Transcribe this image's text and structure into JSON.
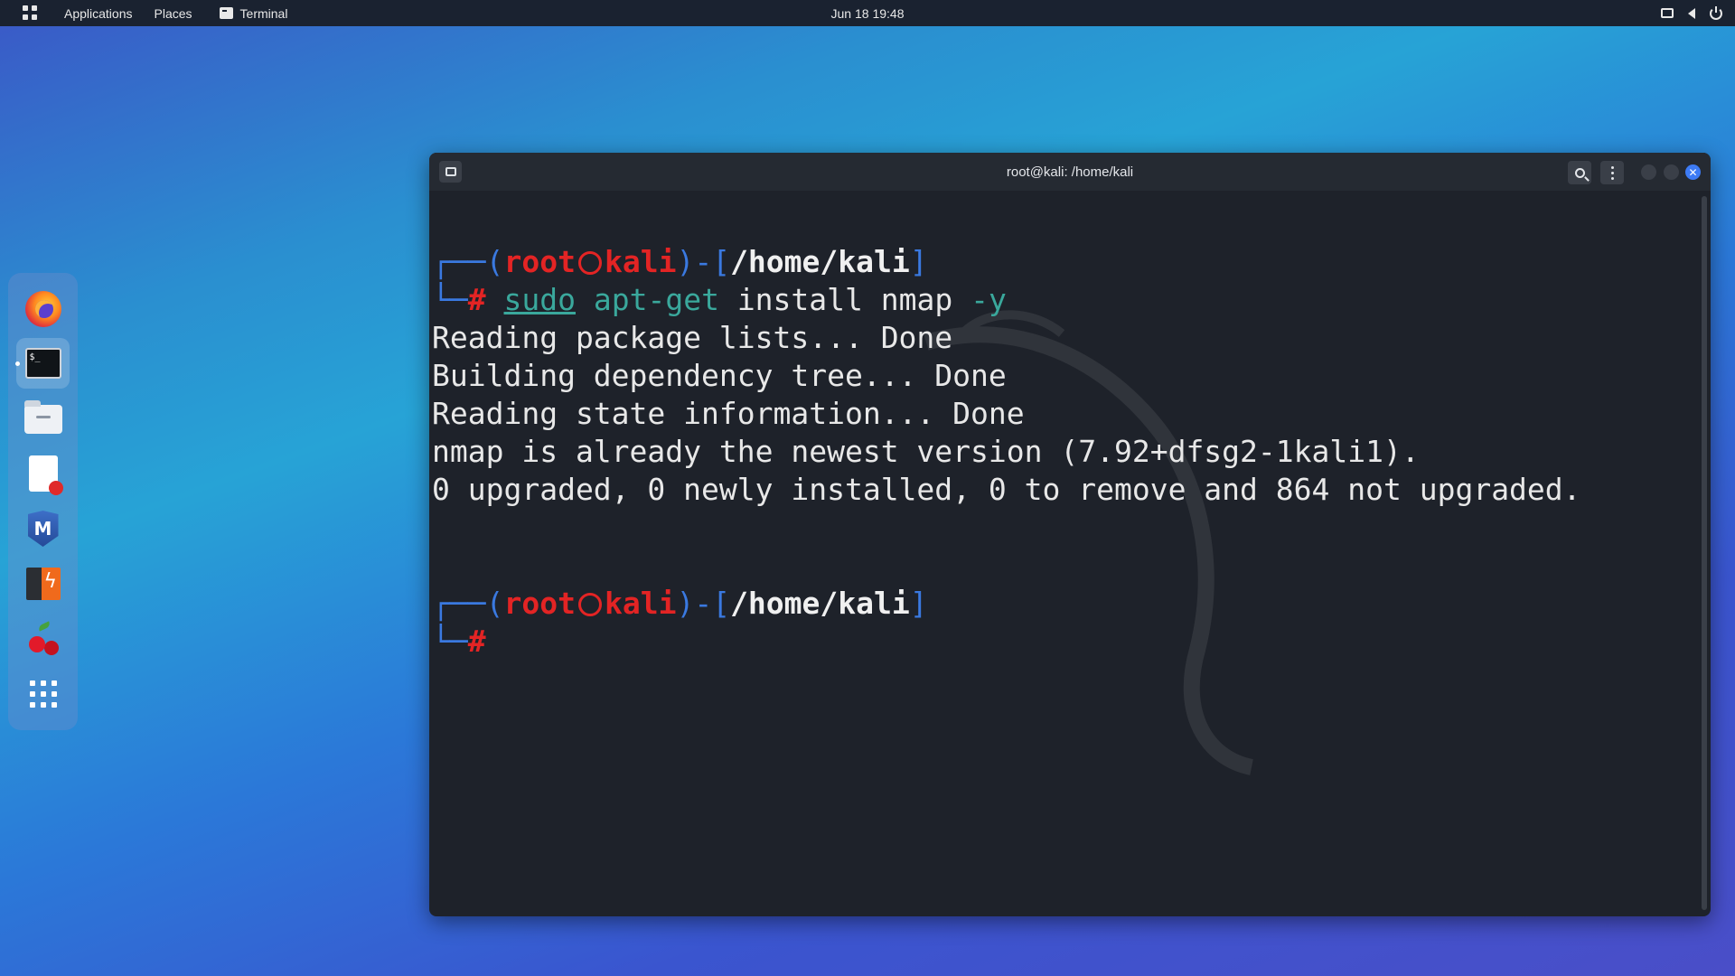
{
  "topbar": {
    "applications": "Applications",
    "places": "Places",
    "terminal_app": "Terminal",
    "clock": "Jun 18  19:48"
  },
  "dock": {
    "items": [
      {
        "name": "firefox"
      },
      {
        "name": "terminal",
        "active": true
      },
      {
        "name": "files"
      },
      {
        "name": "text-editor"
      },
      {
        "name": "metasploit"
      },
      {
        "name": "burp-suite"
      },
      {
        "name": "cherrytree"
      },
      {
        "name": "show-apps"
      }
    ]
  },
  "window": {
    "title": "root@kali: /home/kali"
  },
  "terminal": {
    "prompt1": {
      "open": "┌──(",
      "user": "root",
      "host": "kali",
      "mid": ")-[",
      "path": "/home/kali",
      "close": "]"
    },
    "command": {
      "corner": "└─",
      "hash": "#",
      "sudo": "sudo",
      "cmd": "apt-get",
      "args": "install nmap",
      "flag": "-y"
    },
    "output": [
      "Reading package lists... Done",
      "Building dependency tree... Done",
      "Reading state information... Done",
      "nmap is already the newest version (7.92+dfsg2-1kali1).",
      "0 upgraded, 0 newly installed, 0 to remove and 864 not upgraded."
    ],
    "prompt2": {
      "open": "┌──(",
      "user": "root",
      "host": "kali",
      "mid": ")-[",
      "path": "/home/kali",
      "close": "]",
      "corner": "└─",
      "hash": "#"
    }
  },
  "colors": {
    "prompt_blue": "#3a79e0",
    "prompt_red": "#e32424",
    "command_teal": "#3aa89c",
    "terminal_bg": "#1e222a",
    "topbar_bg": "#1a2230"
  }
}
